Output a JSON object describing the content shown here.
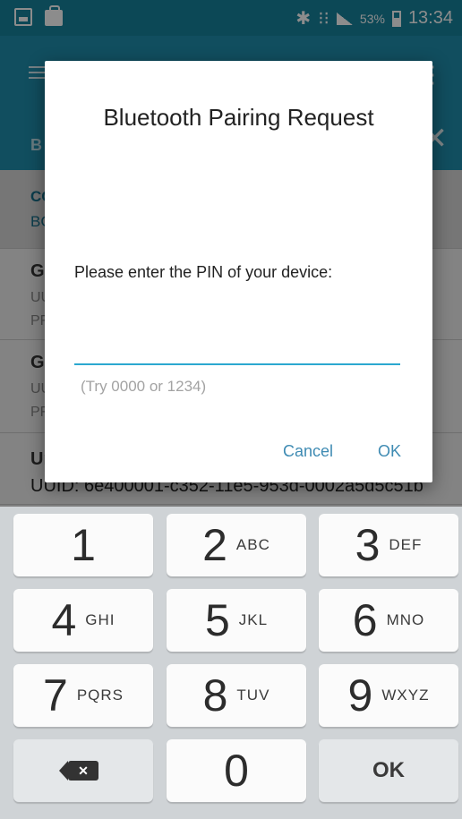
{
  "status_bar": {
    "battery_percent": "53%",
    "time": "13:34",
    "icons": [
      "screenshot-icon",
      "shopping-bag-icon",
      "bluetooth-icon",
      "vibrate-icon",
      "signal-icon",
      "battery-icon"
    ]
  },
  "background": {
    "tab_peek": "B",
    "rows": [
      {
        "title": "CC",
        "subtitle": "BC"
      },
      {
        "title": "Ge",
        "line1": "UU",
        "line2": "PF"
      },
      {
        "title": "Ge",
        "line1": "UU",
        "line2": "PF"
      },
      {
        "title": "Ur",
        "uuid": "UUID: 6e400001-c352-11e5-953d-0002a5d5c51b"
      }
    ]
  },
  "dialog": {
    "title": "Bluetooth Pairing Request",
    "message": "Please enter the PIN of your device:",
    "pin_value": "",
    "hint": "(Try 0000 or 1234)",
    "cancel_label": "Cancel",
    "ok_label": "OK"
  },
  "keyboard": {
    "keys": [
      {
        "num": "1",
        "letters": ""
      },
      {
        "num": "2",
        "letters": "ABC"
      },
      {
        "num": "3",
        "letters": "DEF"
      },
      {
        "num": "4",
        "letters": "GHI"
      },
      {
        "num": "5",
        "letters": "JKL"
      },
      {
        "num": "6",
        "letters": "MNO"
      },
      {
        "num": "7",
        "letters": "PQRS"
      },
      {
        "num": "8",
        "letters": "TUV"
      },
      {
        "num": "9",
        "letters": "WXYZ"
      },
      {
        "num": "0",
        "letters": ""
      }
    ],
    "backspace_icon": "backspace-icon",
    "ok_label": "OK"
  },
  "colors": {
    "status_bar": "#16839d",
    "app_bar": "#1f8fae",
    "accent": "#2ba8d0",
    "dialog_button": "#3f8bb3"
  }
}
